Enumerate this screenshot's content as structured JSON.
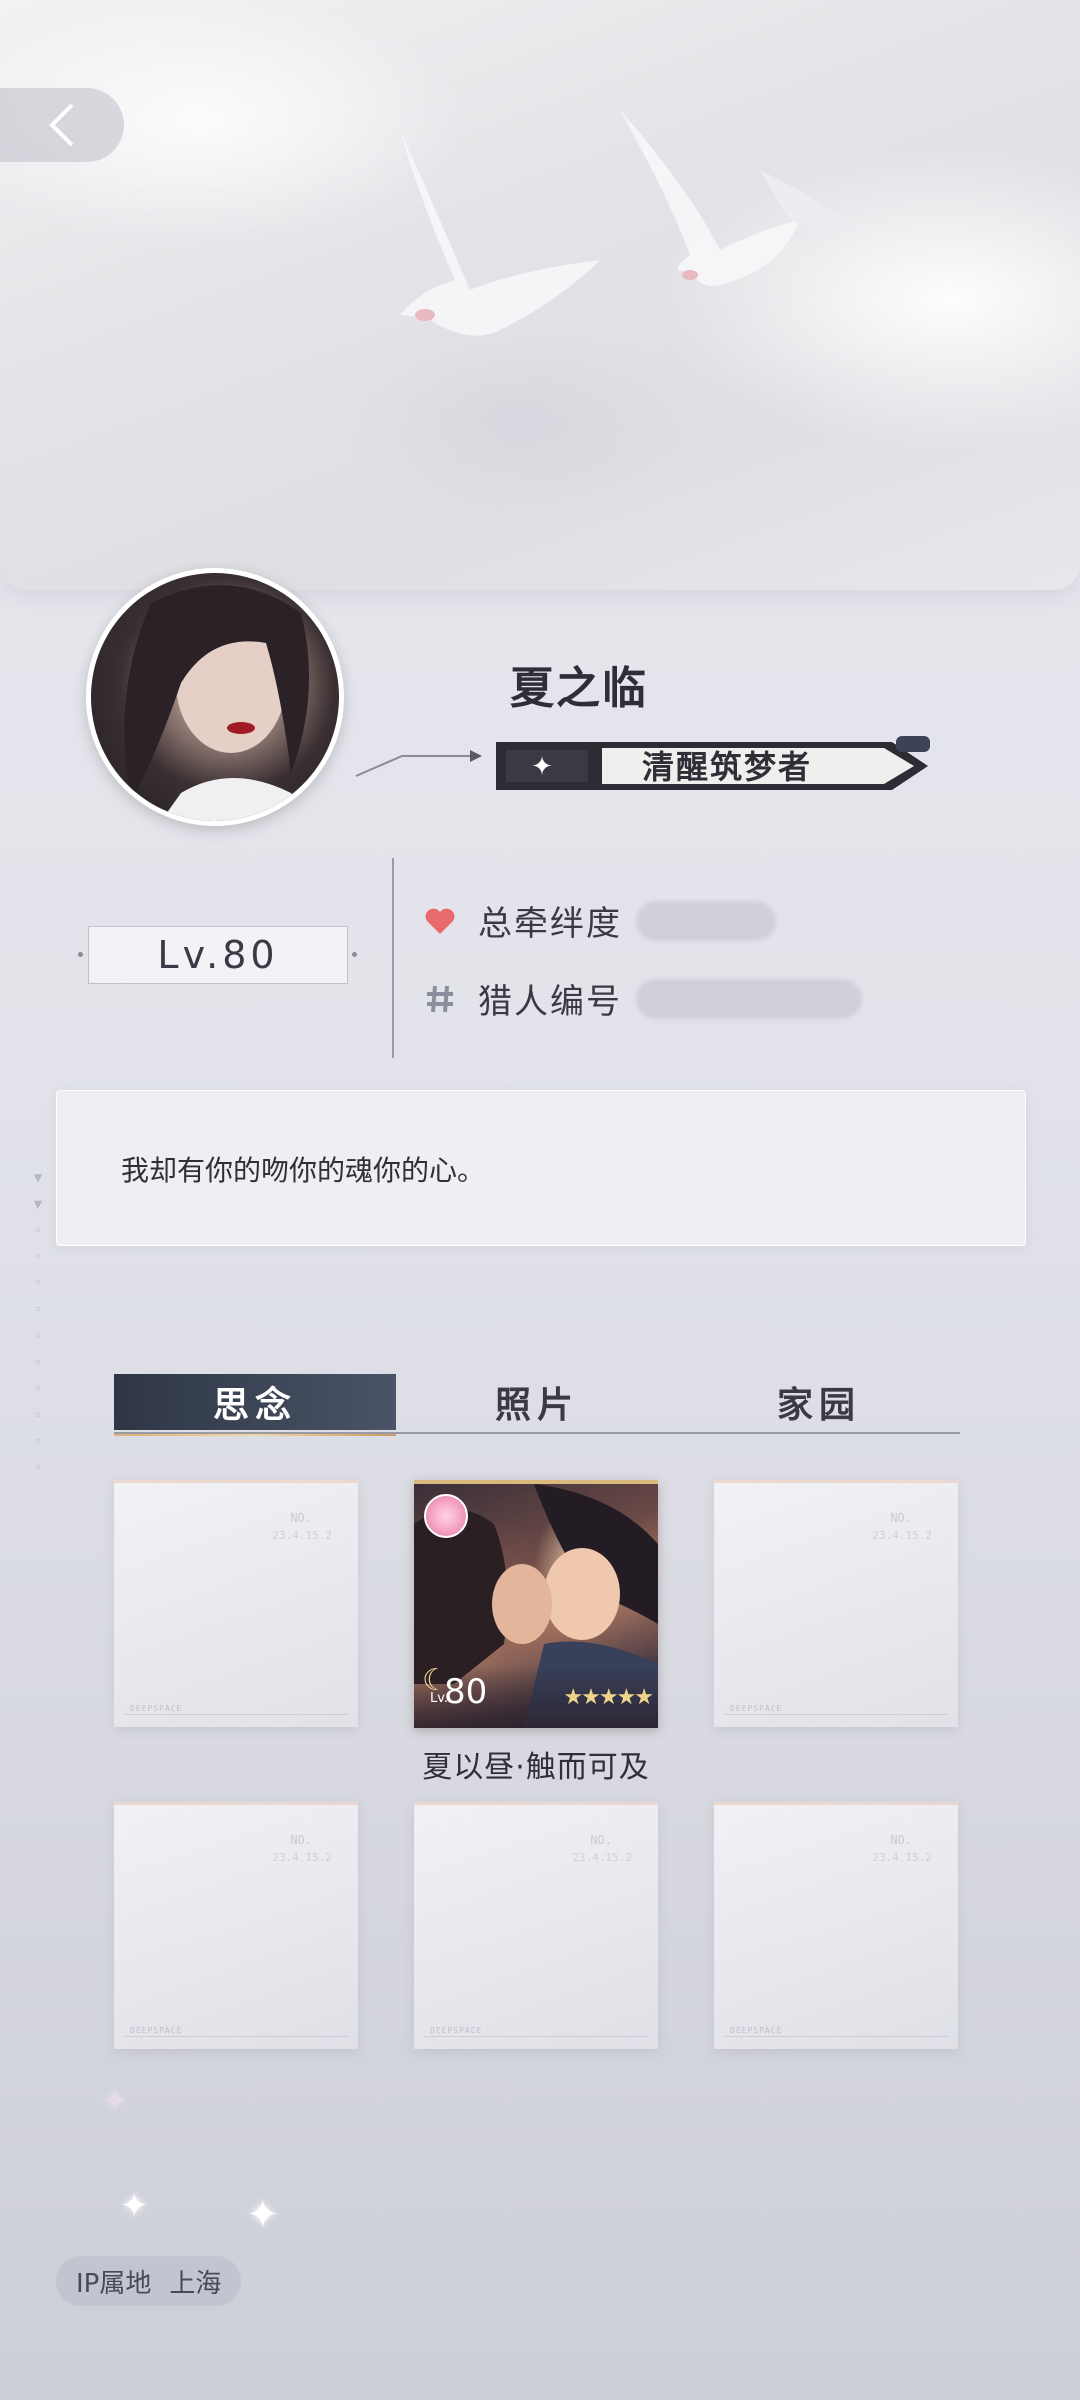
{
  "profile": {
    "name": "夏之临",
    "title_badge": "清醒筑梦者",
    "level": "Lv.80",
    "stats": [
      {
        "icon": "heart-icon",
        "label": "总牵绊度"
      },
      {
        "icon": "hash-icon",
        "label": "猎人编号"
      }
    ],
    "signature": "我却有你的吻你的魂你的心。"
  },
  "tabs": [
    {
      "label": "思念",
      "active": true
    },
    {
      "label": "照片",
      "active": false
    },
    {
      "label": "家园",
      "active": false
    }
  ],
  "cards": {
    "empty_no": "NO.",
    "empty_date": "23.4.15.2",
    "empty_footer": "DEEPSPACE",
    "featured": {
      "level": "80",
      "level_prefix": "Lv.",
      "stars": "★★★★★",
      "caption": "夏以昼·触而可及"
    }
  },
  "ip": {
    "label": "IP属地",
    "location": "上海"
  },
  "colors": {
    "active_tab": "#2e3646",
    "accent_gold": "#d9b97e",
    "heart": "#e86a6a"
  }
}
